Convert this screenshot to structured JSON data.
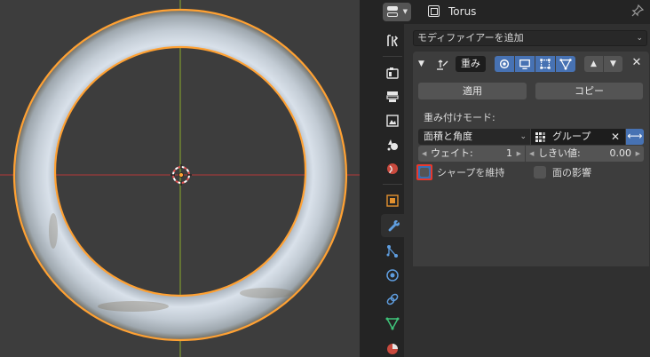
{
  "colors": {
    "accent_blue": "#4772b3",
    "selection_orange": "#ffa133",
    "axis_x_red": "#9b3b3b",
    "axis_y_green": "#7f9a2e",
    "highlight_red": "#e7392d"
  },
  "header": {
    "object_name": "Torus"
  },
  "tabs": [
    {
      "name": "tool",
      "icon": "wrench-screwdriver-icon"
    },
    {
      "name": "render",
      "icon": "camera-back-icon"
    },
    {
      "name": "output",
      "icon": "printer-icon"
    },
    {
      "name": "view-layer",
      "icon": "image-icon"
    },
    {
      "name": "scene",
      "icon": "scene-icon"
    },
    {
      "name": "world",
      "icon": "world-icon"
    },
    {
      "name": "object",
      "icon": "object-square-icon"
    },
    {
      "name": "modifiers",
      "icon": "wrench-icon",
      "active": true
    },
    {
      "name": "particles",
      "icon": "particles-icon"
    },
    {
      "name": "physics",
      "icon": "physics-icon"
    },
    {
      "name": "constraints",
      "icon": "constraint-icon"
    },
    {
      "name": "data",
      "icon": "mesh-data-icon"
    },
    {
      "name": "material",
      "icon": "material-icon"
    }
  ],
  "modifiers": {
    "add_modifier_label": "モディファイアーを追加",
    "panel": {
      "name": "重み",
      "apply_label": "適用",
      "copy_label": "コピー",
      "weight_mode_label": "重み付けモード:",
      "weight_mode_value": "面積と角度",
      "vertex_group_value": "グループ",
      "weight_label": "ウェイト:",
      "weight_value": "1",
      "threshold_label": "しきい値:",
      "threshold_value": "0.00",
      "keep_sharp_label": "シャープを維持",
      "face_influence_label": "面の影響"
    }
  }
}
